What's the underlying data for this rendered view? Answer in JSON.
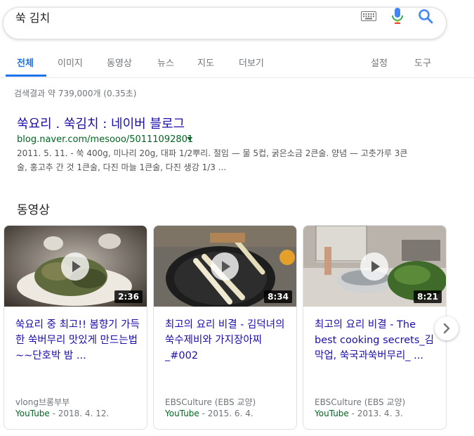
{
  "search": {
    "query": "쑥 김치"
  },
  "tabs": [
    {
      "label": "전체"
    },
    {
      "label": "이미지"
    },
    {
      "label": "동영상"
    },
    {
      "label": "뉴스"
    },
    {
      "label": "지도"
    },
    {
      "label": "더보기"
    },
    {
      "label": "설정"
    },
    {
      "label": "도구"
    }
  ],
  "stats": "검색결과 약 739,000개 (0.35초)",
  "result": {
    "title": "쑥요리 . 쑥김치 : 네이버 블로그",
    "url": "blog.naver.com/mesooo/50111092801",
    "snippet_line1": "2011. 5. 11. - 쑥 400g, 미나리 20g, 대파 1/2뿌리. 절임 — 물 5컵, 굵은소금 2큰술. 양념 — 고춧가루 3큰",
    "snippet_line2": "술, 홍고추 간 것 1큰술, 다진 마늘 1큰술, 다진 생강 1/3 ..."
  },
  "videos_section": {
    "title": "동영상"
  },
  "videos": [
    {
      "title": "쑥요리 중 최고!! 봄향기 가득한 쑥버무리 맛있게 만드는법~~단호박 밤 ...",
      "duration": "2:36",
      "channel": "vlong브롱부부",
      "source": "YouTube",
      "date": "2018. 4. 12."
    },
    {
      "title": "최고의 요리 비결 - 김덕녀의 쑥수제비와 가지장아찌_#002",
      "duration": "8:34",
      "channel": "EBSCulture (EBS 교양)",
      "source": "YouTube",
      "date": "2015. 6. 4."
    },
    {
      "title": "최고의 요리 비결 - The best cooking secrets_김막업, 쑥국과쑥버무리_ ...",
      "duration": "8:21",
      "channel": "EBSCulture (EBS 교양)",
      "source": "YouTube",
      "date": "2013. 4. 3."
    }
  ],
  "icons": {
    "keyboard": "keyboard-icon",
    "mic": "mic-icon",
    "search": "search-icon",
    "play": "play-icon",
    "next": "chevron-right-icon"
  },
  "colors": {
    "link": "#1a0dab",
    "url": "#006621",
    "accent": "#1a73e8",
    "muted": "#70757a"
  }
}
